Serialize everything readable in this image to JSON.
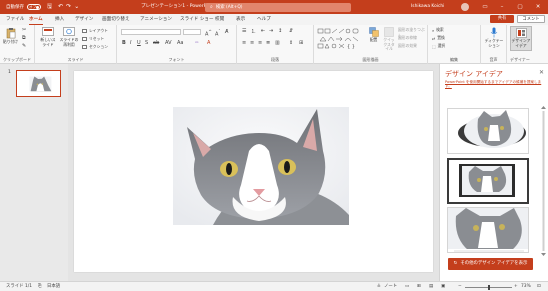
{
  "titlebar": {
    "autosave_label": "自動保存",
    "autosave_state": "オフ",
    "title": "プレゼンテーション1 - PowerPoint",
    "search_placeholder": "検索 (Alt+Q)",
    "user_name": "Ishikawa Koichi",
    "color": "#c43e1c"
  },
  "tabs": [
    {
      "label": "ファイル"
    },
    {
      "label": "ホーム"
    },
    {
      "label": "挿入"
    },
    {
      "label": "デザイン"
    },
    {
      "label": "画面切り替え"
    },
    {
      "label": "アニメーション"
    },
    {
      "label": "スライド ショー"
    },
    {
      "label": "校閲"
    },
    {
      "label": "表示"
    },
    {
      "label": "ヘルプ"
    }
  ],
  "active_tab": "ホーム",
  "share_label": "共有",
  "comment_label": "コメント",
  "ribbon": {
    "clipboard": {
      "label": "クリップボード",
      "paste": "貼り付け"
    },
    "slides": {
      "label": "スライド",
      "new_slide": "新しいスライド",
      "reuse_slide": "スライドの再利用",
      "layout": "レイアウト",
      "reset": "リセット",
      "section": "セクション"
    },
    "font": {
      "label": "フォント"
    },
    "paragraph": {
      "label": "段落"
    },
    "drawing": {
      "label": "図形描画",
      "arrange": "配置",
      "quick_styles": "クイックスタイル",
      "shape_fill": "図形の塗りつぶし",
      "shape_outline": "図形の枠線",
      "shape_effects": "図形の効果"
    },
    "editing": {
      "label": "編集",
      "find": "検索",
      "replace": "置換",
      "select": "選択"
    },
    "voice": {
      "label": "音声",
      "dictate": "ディクテーション"
    },
    "designer": {
      "label": "デザイナー",
      "button": "デザインアイデア"
    }
  },
  "slides_pane": {
    "slide_number": "1"
  },
  "designer_pane": {
    "title": "デザイン アイデア",
    "link_text": "PowerPoint を使用開始するまでアイデアの候補を提案します。",
    "more_button": "その他のデザイン アイデアを表示"
  },
  "statusbar": {
    "slide_info": "スライド 1/1",
    "language": "日本語",
    "notes": "ノート",
    "zoom": "73%",
    "zoom_fraction": 0.5
  }
}
